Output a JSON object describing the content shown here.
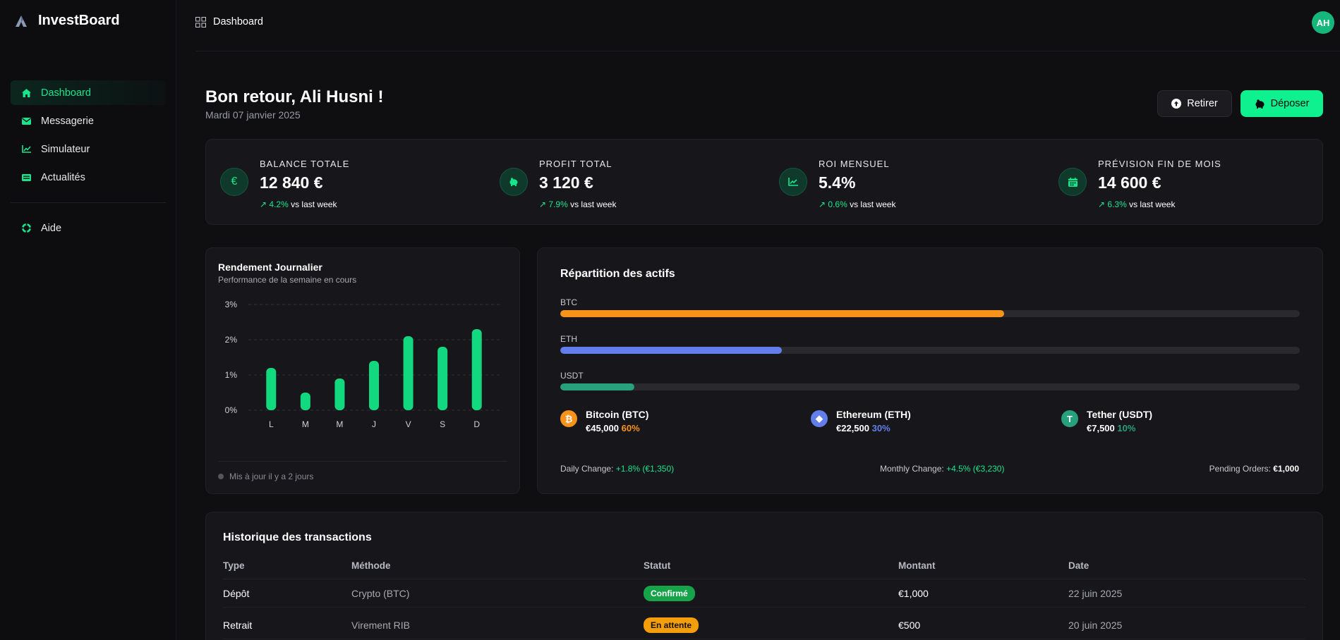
{
  "brand": {
    "name": "InvestBoard"
  },
  "sidebar": {
    "items": [
      {
        "label": "Dashboard",
        "icon": "home-icon",
        "active": true
      },
      {
        "label": "Messagerie",
        "icon": "envelope-icon"
      },
      {
        "label": "Simulateur",
        "icon": "chart-line-icon"
      },
      {
        "label": "Actualités",
        "icon": "newspaper-icon"
      }
    ],
    "help": {
      "label": "Aide",
      "icon": "lifebuoy-icon"
    }
  },
  "topbar": {
    "breadcrumb": "Dashboard",
    "avatar_initials": "AH"
  },
  "header": {
    "welcome": "Bon retour, Ali Husni !",
    "date": "Mardi 07 janvier 2025",
    "withdraw_label": "Retirer",
    "deposit_label": "Déposer"
  },
  "stats": [
    {
      "label": "BALANCE TOTALE",
      "value": "12 840 €",
      "change": "↗ 4.2%",
      "suffix": " vs last week",
      "icon": "euro-icon"
    },
    {
      "label": "PROFIT TOTAL",
      "value": "3 120 €",
      "change": "↗ 7.9%",
      "suffix": " vs last week",
      "icon": "piggy-bank-icon"
    },
    {
      "label": "ROI MENSUEL",
      "value": "5.4%",
      "change": "↗ 0.6%",
      "suffix": " vs last week",
      "icon": "trend-icon"
    },
    {
      "label": "PRÉVISION FIN DE MOIS",
      "value": "14 600 €",
      "change": "↗ 6.3%",
      "suffix": " vs last week",
      "icon": "calendar-icon"
    }
  ],
  "daily": {
    "title": "Rendement Journalier",
    "subtitle": "Performance de la semaine en cours",
    "footer": "Mis à jour il y a 2 jours"
  },
  "chart_data": {
    "type": "bar",
    "categories": [
      "L",
      "M",
      "M",
      "J",
      "V",
      "S",
      "D"
    ],
    "values": [
      1.2,
      0.5,
      0.9,
      1.4,
      2.1,
      1.8,
      2.3
    ],
    "ylim": [
      0,
      3
    ],
    "yticks": [
      "0%",
      "1%",
      "2%",
      "3%"
    ],
    "grid": true,
    "color": "#12d97f"
  },
  "assets": {
    "title": "Répartition des actifs",
    "bars": [
      {
        "label": "BTC",
        "pct": 60,
        "color": "#f7931a"
      },
      {
        "label": "ETH",
        "pct": 30,
        "color": "#627eea"
      },
      {
        "label": "USDT",
        "pct": 10,
        "color": "#26a17b"
      }
    ],
    "coins": [
      {
        "name": "Bitcoin (BTC)",
        "amount": "€45,000",
        "pct": "60%",
        "color": "#f7931a",
        "glyph": "₿",
        "icon": "bitcoin-icon"
      },
      {
        "name": "Ethereum (ETH)",
        "amount": "€22,500",
        "pct": "30%",
        "color": "#627eea",
        "glyph": "◆",
        "icon": "ethereum-icon"
      },
      {
        "name": "Tether (USDT)",
        "amount": "€7,500",
        "pct": "10%",
        "color": "#26a17b",
        "glyph": "T",
        "icon": "tether-icon"
      }
    ],
    "daily_change_label": "Daily Change:",
    "daily_change_value": "+1.8% (€1,350)",
    "monthly_change_label": "Monthly Change:",
    "monthly_change_value": "+4.5% (€3,230)",
    "pending_label": "Pending Orders:",
    "pending_value": "€1,000"
  },
  "transactions": {
    "title": "Historique des transactions",
    "headers": [
      "Type",
      "Méthode",
      "Statut",
      "Montant",
      "Date"
    ],
    "rows": [
      {
        "type": "Dépôt",
        "method": "Crypto (BTC)",
        "status": "Confirmé",
        "status_color": "#16a34a",
        "status_text_color": "#ffffff",
        "amount": "€1,000",
        "date": "22 juin 2025"
      },
      {
        "type": "Retrait",
        "method": "Virement RIB",
        "status": "En attente",
        "status_color": "#f59e0b",
        "status_text_color": "#111111",
        "amount": "€500",
        "date": "20 juin 2025"
      }
    ]
  }
}
